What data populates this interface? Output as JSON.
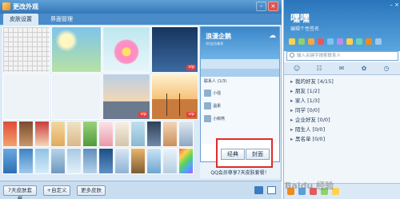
{
  "dialog": {
    "title": "更改外观",
    "tabs": {
      "skin": "皮肤设置",
      "ui": "界面管理"
    },
    "vip_badge": "vip",
    "preview": {
      "name": "浪漫企鹅",
      "subtitle": "QQ会员尊享",
      "list_header": "联系人 (1/3)",
      "contacts": [
        "小强",
        "温柔",
        "小柳燕"
      ],
      "mode_classic": "经典",
      "mode_cover": "封面",
      "promo": "QQ会员尊享7天皮肤套餐！"
    },
    "bottom": {
      "seven_day": "7天皮肤套餐",
      "custom": "自定义",
      "more": "更多皮肤"
    }
  },
  "qq": {
    "nickname": "嘿嘿",
    "signature": "编辑个性签名",
    "search_placeholder": "输入关键字搜索联系人",
    "groups": [
      "我的好友 [4/15]",
      "朋友 [1/2]",
      "家人 [1/3]",
      "同学 [0/0]",
      "企业好友 [0/0]",
      "陌生人 [0/0]",
      "黑名单 [0/0]"
    ]
  },
  "watermark": "Baidu 经验",
  "colors": {
    "accent": "#3478b9",
    "highlight_border": "#e02b2b"
  }
}
